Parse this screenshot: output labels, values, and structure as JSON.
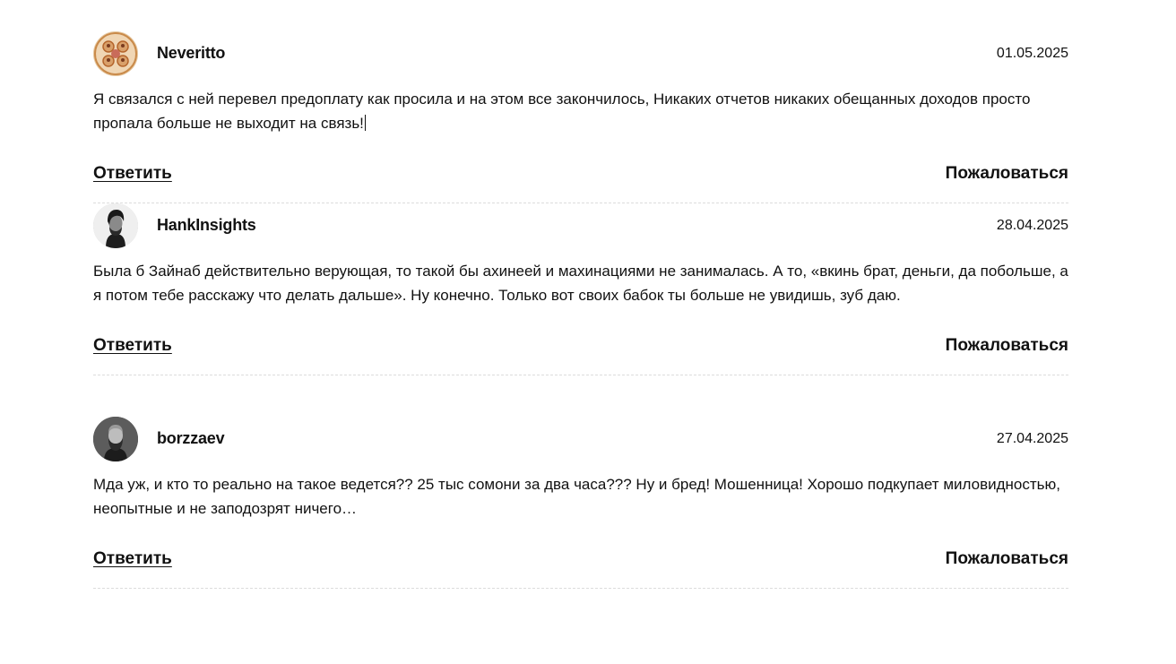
{
  "comments": [
    {
      "username": "Neveritto",
      "date": "01.05.2025",
      "text": "Я связался с ней перевел предоплату как просила и на этом все закончилось, Никаких отчетов никаких обещанных доходов просто пропала больше не выходит на связь!",
      "avatar": "avatar-icon",
      "reply_label": "Ответить",
      "complain_label": "Пожаловаться"
    },
    {
      "username": "HankInsights",
      "date": "28.04.2025",
      "text": "Была б Зайнаб действительно верующая, то такой бы ахинеей и махинациями не занималась. А то, «вкинь брат, деньги, да побольше, а я потом тебе расскажу что делать дальше». Ну конечно. Только вот своих бабок ты больше не увидишь, зуб даю.",
      "avatar": "avatar-icon",
      "reply_label": "Ответить",
      "complain_label": "Пожаловаться"
    },
    {
      "username": "borzzaev",
      "date": "27.04.2025",
      "text": "Мда уж, и кто то реально на такое ведется?? 25 тыс сомони за два часа??? Ну и бред! Мошенница! Хорошо подкупает миловидностью, неопытные и не заподозрят ничего…",
      "avatar": "avatar-icon",
      "reply_label": "Ответить",
      "complain_label": "Пожаловаться"
    }
  ]
}
